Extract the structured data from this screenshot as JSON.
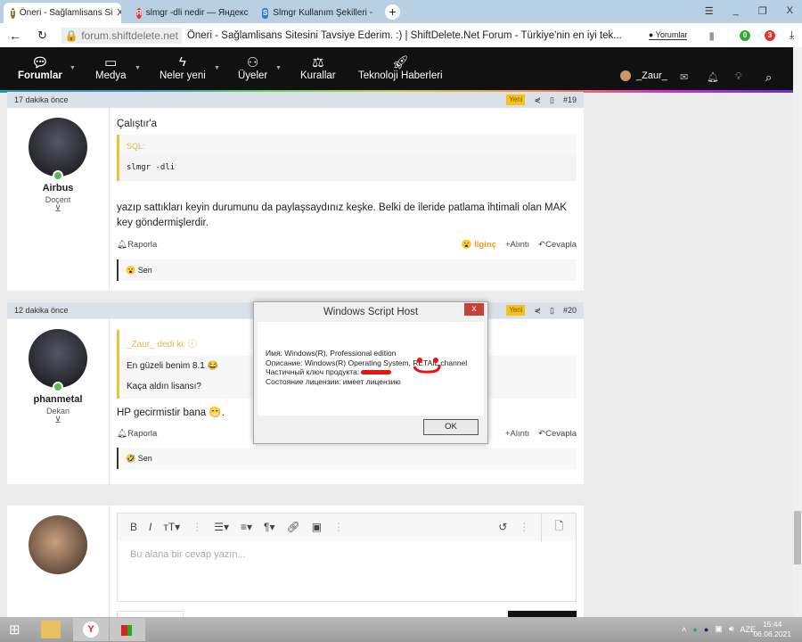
{
  "browser": {
    "tabs": [
      {
        "title": "Öneri - Sağlamlisans Si",
        "close": "X"
      },
      {
        "title": "slmgr -dli nedir — Яндекс"
      },
      {
        "title": "Slmgr Kullanım Şekilleri -"
      }
    ],
    "new_tab": "+",
    "window_controls": [
      "☰",
      "_",
      "❐",
      "X"
    ],
    "domain": "forum.shiftdelete.net",
    "page_title": "Öneri - Sağlamlisans Sitesini Tavsiye Ederim. :) | ShiftDelete.Net Forum - Türkiye'nin en iyi tek...",
    "comments_button": "Yorumlar",
    "ext_badges": [
      "0",
      "3"
    ]
  },
  "nav": {
    "items": [
      "Forumlar",
      "Medya",
      "Neler yeni",
      "Üyeler",
      "Kurallar",
      "Teknoloji Haberleri"
    ],
    "user": "_Zaur_"
  },
  "posts": [
    {
      "time": "17 dakika önce",
      "badge": "Yeni",
      "number": "#19",
      "author": "Airbus",
      "rank": "Doçent",
      "intro": "Çalıştır'a",
      "code_label": "SQL:",
      "code": "slmgr -dli",
      "text": "yazıp sattıkları keyin durumunu da paylaşsaydınız keşke. Belki de ileride patlama ihtimali olan MAK key göndermişlerdir.",
      "report": "Raporla",
      "reaction_label": "İlginç",
      "quote": "Alıntı",
      "reply": "Cevapla",
      "reaction_emoji": "😮",
      "reacted_by": "Sen"
    },
    {
      "time": "12 dakika önce",
      "badge": "Yeni",
      "number": "#20",
      "author": "phanmetal",
      "rank": "Dekan",
      "quote_author": "_Zaur_ dedi ki:",
      "quote_lines": [
        "En güzeli benim 8.1 😂",
        "Kaça aldın lisansı?"
      ],
      "text": "HP gecirmistir bana 😁.",
      "report": "Raporla",
      "quote": "Alıntı",
      "reply": "Cevapla",
      "reaction_emoji": "🤣",
      "reacted_by": "Sen"
    }
  ],
  "editor": {
    "placeholder": "Bu alana bir cevap yazın..."
  },
  "dialog": {
    "title": "Windows Script Host",
    "close": "x",
    "lines": [
      "Имя: Windows(R), Professional edition",
      "Описание: Windows(R) Operating System, RETAIL channel",
      "Частичный ключ продукта:",
      "Состояние лицензии: имеет лицензию"
    ],
    "ok": "OK"
  },
  "taskbar": {
    "lang": "AZE",
    "time": "15:44",
    "date": "06.06.2021"
  }
}
